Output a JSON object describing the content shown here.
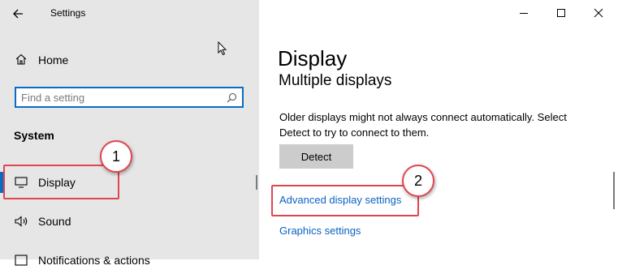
{
  "window": {
    "title": "Settings",
    "controls": {
      "minimize": "minimize-icon",
      "maximize": "maximize-icon",
      "close": "close-icon"
    }
  },
  "sidebar": {
    "back_icon": "back-arrow-icon",
    "home_label": "Home",
    "search": {
      "placeholder": "Find a setting",
      "value": ""
    },
    "section_label": "System",
    "items": [
      {
        "label": "Display",
        "icon": "monitor-icon",
        "selected": true
      },
      {
        "label": "Sound",
        "icon": "speaker-icon",
        "selected": false
      },
      {
        "label": "Notifications & actions",
        "icon": "notification-icon",
        "selected": false
      }
    ]
  },
  "main": {
    "page_title": "Display",
    "sub_heading": "Multiple displays",
    "description": "Older displays might not always connect automatically. Select Detect to try to connect to them.",
    "detect_button": "Detect",
    "links": {
      "advanced": "Advanced display settings",
      "graphics": "Graphics settings"
    }
  },
  "annotations": {
    "callout_1": "1",
    "callout_2": "2",
    "color": "#e0464f"
  },
  "colors": {
    "accent": "#0a6dc5",
    "link": "#0a62c2",
    "sidebar_bg": "#e6e6e6"
  }
}
